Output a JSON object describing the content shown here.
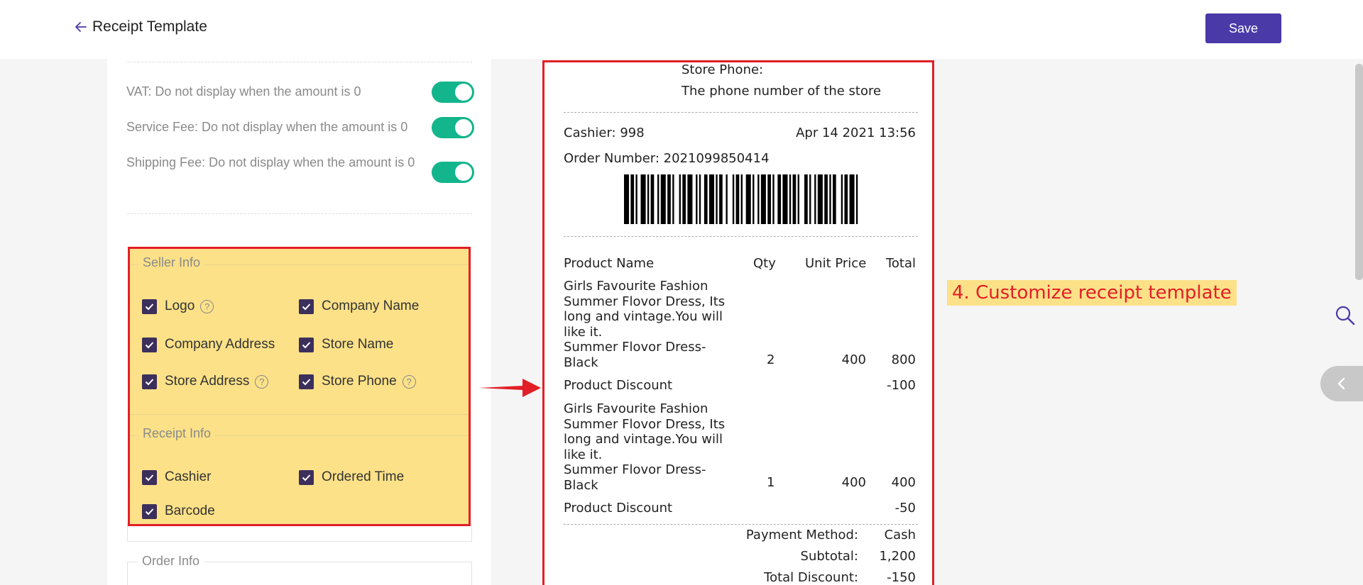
{
  "header": {
    "title": "Receipt Template",
    "save_label": "Save"
  },
  "toggles": [
    {
      "label": "VAT: Do not display when the amount is 0",
      "on": true
    },
    {
      "label": "Service Fee: Do not display when the amount is 0",
      "on": true
    },
    {
      "label": "Shipping Fee: Do not display when the amount is 0",
      "on": true
    }
  ],
  "seller_info": {
    "legend": "Seller Info",
    "items": [
      "Logo",
      "Company Name",
      "Company Address",
      "Store Name",
      "Store Address",
      "Store Phone"
    ]
  },
  "receipt_info": {
    "legend": "Receipt Info",
    "items": [
      "Cashier",
      "Ordered Time",
      "Barcode"
    ]
  },
  "order_info": {
    "legend": "Order Info"
  },
  "receipt": {
    "store_phone_label": "Store Phone:",
    "store_phone_value": "The phone number of the store",
    "cashier": "Cashier: 998",
    "datetime": "Apr 14 2021 13:56",
    "order_number": "Order Number: 2021099850414",
    "headers": [
      "Product Name",
      "Qty",
      "Unit Price",
      "Total"
    ],
    "products": [
      {
        "name": "Girls Favourite Fashion Summer Flovor Dress, Its long and vintage.You will like it.",
        "variant": "Summer Flovor Dress-Black",
        "qty": "2",
        "unit_price": "400",
        "total": "800",
        "discount_label": "Product Discount",
        "discount": "-100"
      },
      {
        "name": "Girls Favourite Fashion Summer Flovor Dress, Its long and vintage.You will like it.",
        "variant": "Summer Flovor Dress-Black",
        "qty": "1",
        "unit_price": "400",
        "total": "400",
        "discount_label": "Product Discount",
        "discount": "-50"
      }
    ],
    "summary": [
      {
        "label": "Payment Method:",
        "value": "Cash"
      },
      {
        "label": "Subtotal:",
        "value": "1,200"
      },
      {
        "label": "Total Discount:",
        "value": "-150"
      }
    ]
  },
  "annotation": "4. Customize receipt template",
  "colors": {
    "accent": "#4a3aa8",
    "toggle_on": "#13b58c",
    "highlight": "#fce188",
    "annotation_red": "#e21f26",
    "checkbox": "#3c2f5c"
  }
}
